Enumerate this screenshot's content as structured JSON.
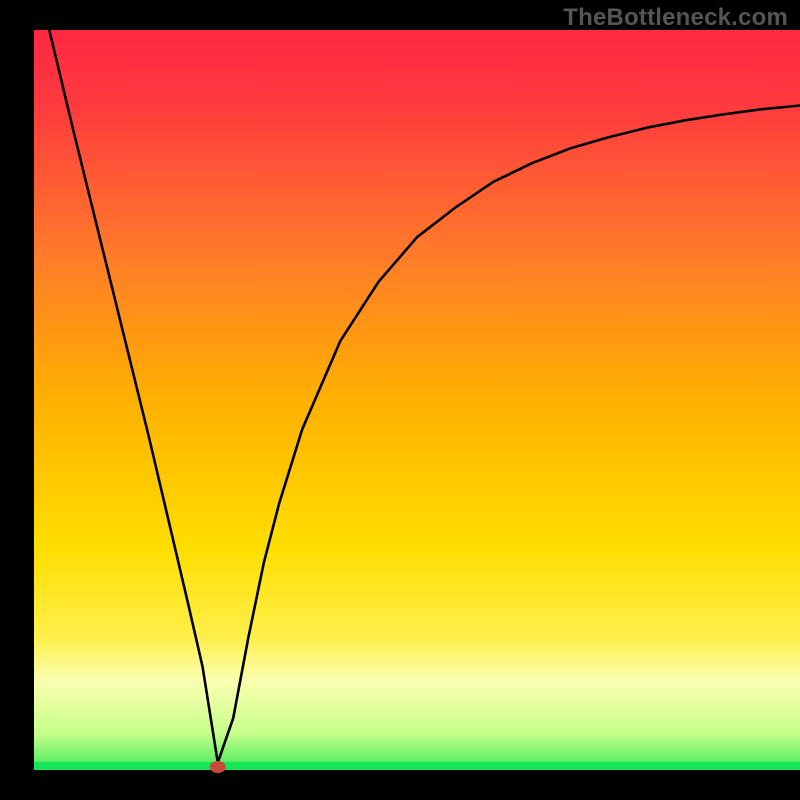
{
  "watermark": "TheBottleneck.com",
  "chart_data": {
    "type": "line",
    "title": "",
    "xlabel": "",
    "ylabel": "",
    "xlim": [
      0,
      100
    ],
    "ylim": [
      0,
      100
    ],
    "grid": false,
    "legend": false,
    "background_gradient": {
      "top": "#ff2843",
      "middle": "#ffde00",
      "bottom_band": "#faffb0",
      "base": "#16e558"
    },
    "marker": {
      "x": 24,
      "y": 0,
      "color": "#c94a3a",
      "shape": "ellipse"
    },
    "series": [
      {
        "name": "curve",
        "x": [
          2,
          5,
          10,
          15,
          20,
          22,
          24,
          26,
          28,
          30,
          32,
          35,
          40,
          45,
          50,
          55,
          60,
          65,
          70,
          75,
          80,
          85,
          90,
          95,
          100
        ],
        "values": [
          100,
          87,
          66,
          45,
          23,
          14,
          1,
          7,
          18,
          28,
          36,
          46,
          58,
          66,
          72,
          76,
          79.5,
          82,
          84,
          85.5,
          86.8,
          87.8,
          88.6,
          89.3,
          89.8
        ]
      }
    ],
    "annotations": []
  }
}
